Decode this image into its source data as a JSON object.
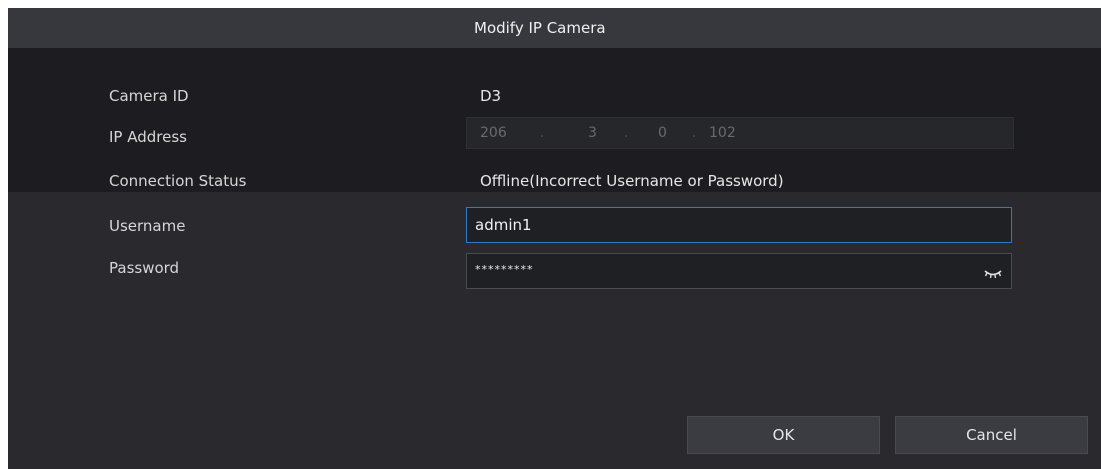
{
  "dialog": {
    "title": "Modify IP Camera"
  },
  "fields": {
    "camera_id": {
      "label": "Camera ID",
      "value": "D3"
    },
    "ip_address": {
      "label": "IP Address",
      "octets": [
        "206",
        "3",
        "0",
        "102"
      ],
      "separator": "."
    },
    "connection_status": {
      "label": "Connection Status",
      "value": "Offline(Incorrect Username or Password)"
    },
    "username": {
      "label": "Username",
      "value": "admin1"
    },
    "password": {
      "label": "Password",
      "value": "*********",
      "icon": "eye-closed-icon"
    }
  },
  "buttons": {
    "ok": "OK",
    "cancel": "Cancel"
  },
  "colors": {
    "background": "#2a2a2e",
    "header": "#37383d",
    "focus_border": "#2f79c9"
  }
}
